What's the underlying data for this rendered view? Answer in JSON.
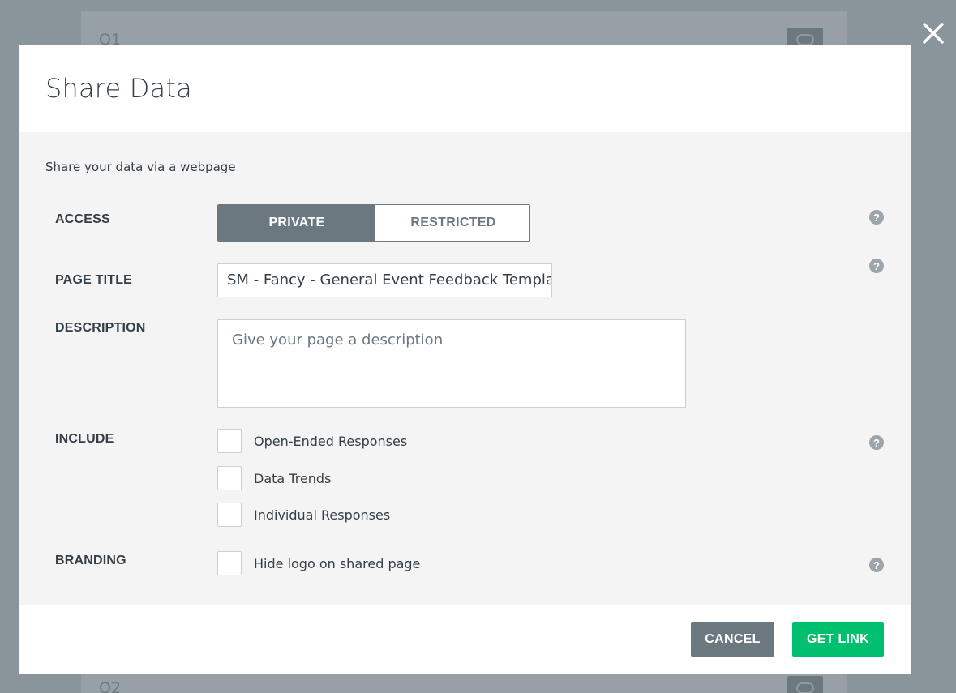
{
  "background": {
    "question_top": "Q1",
    "question_bottom": "Q2"
  },
  "modal": {
    "title": "Share Data",
    "intro": "Share your data via a webpage",
    "access": {
      "label": "ACCESS",
      "options": [
        "PRIVATE",
        "RESTRICTED"
      ],
      "selected": "PRIVATE"
    },
    "page_title": {
      "label": "PAGE TITLE",
      "value": "SM - Fancy - General Event Feedback Template"
    },
    "description": {
      "label": "DESCRIPTION",
      "placeholder": "Give your page a description"
    },
    "include": {
      "label": "INCLUDE",
      "options": [
        {
          "label": "Open-Ended Responses",
          "checked": false
        },
        {
          "label": "Data Trends",
          "checked": false
        },
        {
          "label": "Individual Responses",
          "checked": false
        }
      ]
    },
    "branding": {
      "label": "BRANDING",
      "option": {
        "label": "Hide logo on shared page",
        "checked": false
      }
    },
    "help_symbol": "?",
    "buttons": {
      "cancel": "CANCEL",
      "get_link": "GET LINK"
    }
  },
  "icons": {
    "close": "close-icon",
    "help": "help-icon",
    "comment": "comment-icon"
  },
  "colors": {
    "overlay": "#8a949b",
    "primary_green": "#00bf6f",
    "secondary_gray": "#6b7880",
    "text_dark": "#333e48",
    "body_bg": "#f4f4f4"
  }
}
